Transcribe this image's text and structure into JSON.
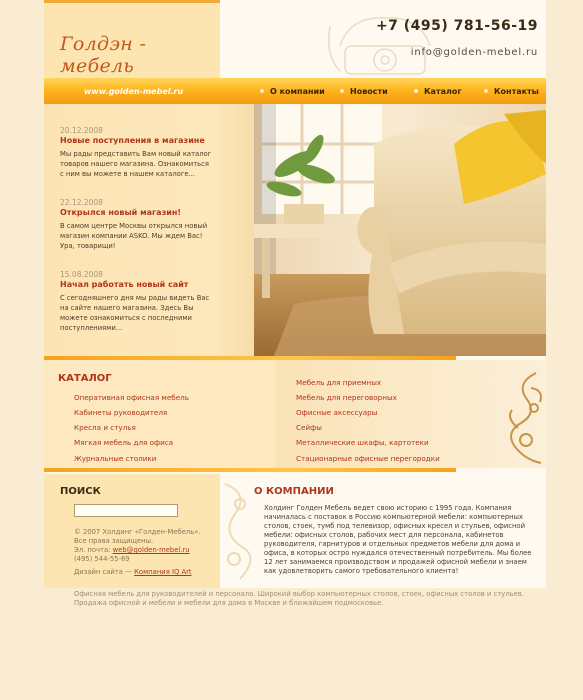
{
  "header": {
    "logo": "Голдэн - мебель",
    "phone": "+7 (495) 781-56-19",
    "email": "info@golden-mebel.ru"
  },
  "nav": {
    "url": "www.golden-mebel.ru",
    "items": [
      "О компании",
      "Новости",
      "Каталог",
      "Контакты"
    ]
  },
  "news": [
    {
      "date": "20.12.2008",
      "title": "Новые поступления в магазине",
      "text": "Мы рады представить Вам новый каталог товаров нашего магазина. Ознакомиться с ним вы можете в нашем каталоге..."
    },
    {
      "date": "22.12.2008",
      "title": "Открылся новый магазин!",
      "text": "В самом центре Москвы открылся новый магазин компании ASKO. Мы ждем Вас! Ура, товарищи!"
    },
    {
      "date": "15.08.2008",
      "title": "Начал работать новый сайт",
      "text": "С сегодняшнего дня мы рады видеть Вас на сайте нашего магазина. Здесь Вы можете ознакомиться с последними поступлениями..."
    }
  ],
  "catalog": {
    "title": "КАТАЛОГ",
    "left": [
      "Оперативная офисная мебель",
      "Кабинеты руководителя",
      "Кресла и стулья",
      "Мягкая мебель для офиса",
      "Журнальные столики"
    ],
    "right": [
      "Мебель для приемных",
      "Мебель для переговорных",
      "Офисные аксессуары",
      "Сейфы",
      "Металлические шкафы, картотеки",
      "Стационарные офисные перегородки"
    ]
  },
  "search": {
    "title": "ПОИСК",
    "value": ""
  },
  "footer": {
    "copyright": "© 2007 Холдинг «Голден-Мебель».",
    "rights": "Все права защищены.",
    "email_label": "Эл. почта:",
    "email": "web@golden-mebel.ru",
    "phone": "(495) 544-55-69",
    "design_label": "Дизайн сайта —",
    "design_link": "Компания IQ Art"
  },
  "about": {
    "title": "О КОМПАНИИ",
    "text": "Холдинг Голден Мебель ведет свою историю с 1995 года. Компания начиналась с поставок в Россию компьютерной мебели: компьютерных столов, стоек, тумб под телевизор, офисных кресел и стульев, офисной мебели: офисных столов, рабочих мест для персонала, кабинетов руководителя, гарнитуров и отдельных предметов мебели для дома и офиса, в которых остро нуждался отечественный потребитель. Мы более 12 лет занимаемся производством и продажей офисной мебели и знаем как удовлетворить самого требовательного клиента!"
  },
  "bottom_description": "Офисная мебель для руководителей и персонала. Широкий выбор компьютерных столов, стоек, офисных столов и стульев. Продажа офисной и мебели и мебели для дома в Москве и ближайшем подмосковье.",
  "colors": {
    "accent": "#b0361b",
    "nav": "#ffb520",
    "background": "#faecd2"
  }
}
